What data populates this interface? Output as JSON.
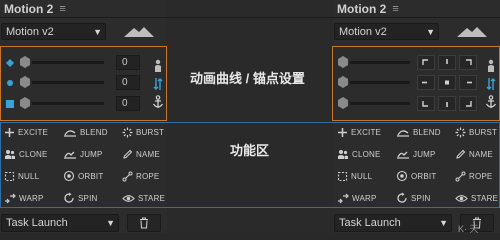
{
  "panel_title": "Motion 2",
  "version_select": "Motion v2",
  "slider_values": [
    "0",
    "0",
    "0"
  ],
  "buttons": [
    {
      "label": "EXCITE",
      "icon": "plus-icon"
    },
    {
      "label": "BLEND",
      "icon": "blend-icon"
    },
    {
      "label": "BURST",
      "icon": "burst-icon"
    },
    {
      "label": "CLONE",
      "icon": "clone-icon"
    },
    {
      "label": "JUMP",
      "icon": "jump-icon"
    },
    {
      "label": "NAME",
      "icon": "pencil-icon"
    },
    {
      "label": "NULL",
      "icon": "null-icon"
    },
    {
      "label": "ORBIT",
      "icon": "orbit-icon"
    },
    {
      "label": "ROPE",
      "icon": "rope-icon"
    },
    {
      "label": "WARP",
      "icon": "warp-icon"
    },
    {
      "label": "SPIN",
      "icon": "spin-icon"
    },
    {
      "label": "STARE",
      "icon": "eye-icon"
    }
  ],
  "task_select": "Task Launch",
  "annotations": {
    "curves": "动画曲线 / 锚点设置",
    "functions": "功能区"
  },
  "watermark": "K· 天",
  "colors": {
    "bg": "#2c2c2c",
    "accent_orange": "#c8752a",
    "accent_blue": "#2f6fa8",
    "cyan": "#3aa3d6"
  }
}
